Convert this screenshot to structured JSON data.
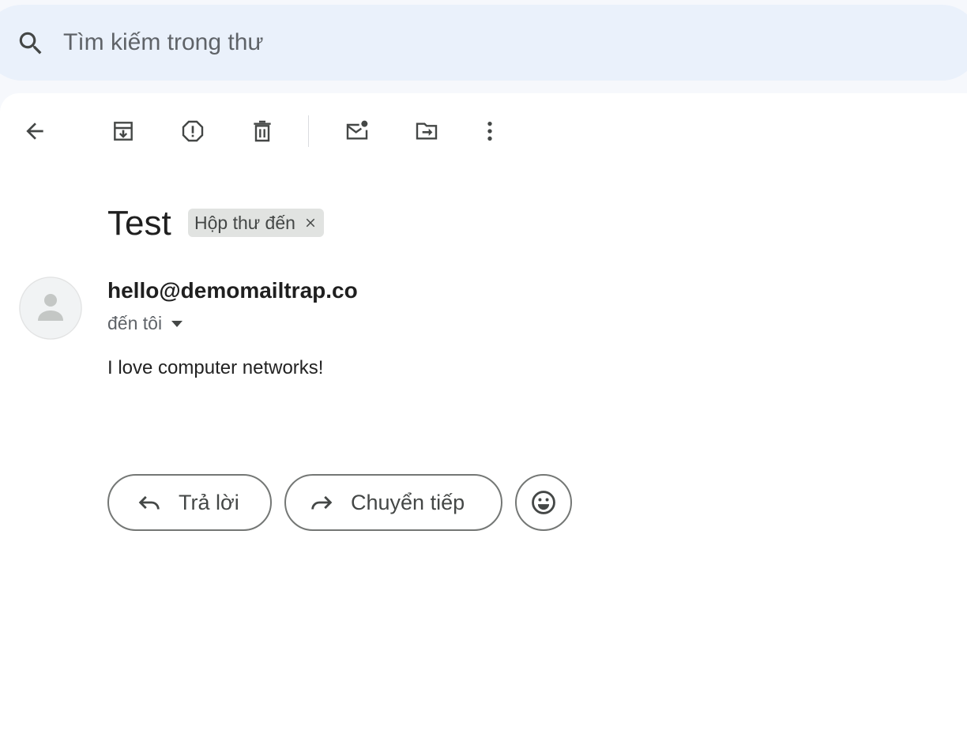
{
  "search": {
    "placeholder": "Tìm kiếm trong thư"
  },
  "toolbar": {
    "back_icon": "arrow-left-icon",
    "archive_icon": "archive-icon",
    "spam_icon": "report-spam-icon",
    "delete_icon": "trash-icon",
    "mark_unread_icon": "mark-unread-icon",
    "move_icon": "move-to-icon",
    "more_icon": "more-vert-icon"
  },
  "message": {
    "subject": "Test",
    "label": "Hộp thư đến",
    "sender": "hello@demomailtrap.co",
    "recipient": "đến tôi",
    "body": "I love computer networks!"
  },
  "actions": {
    "reply_label": "Trả lời",
    "forward_label": "Chuyển tiếp",
    "emoji_icon": "emoji-icon"
  },
  "colors": {
    "background": "#f6f8fc",
    "search_bg": "#eaf1fb",
    "icon": "#444746",
    "chip_bg": "#e1e3e1"
  }
}
